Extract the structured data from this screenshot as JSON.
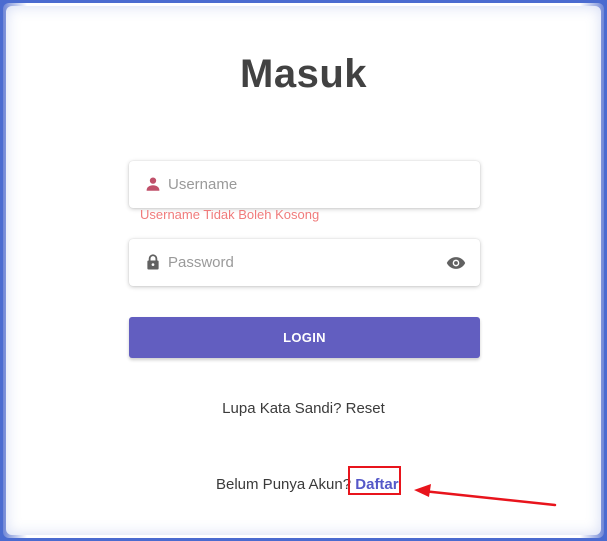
{
  "page": {
    "title": "Masuk"
  },
  "form": {
    "username": {
      "placeholder": "Username",
      "value": "",
      "error": "Username Tidak Boleh Kosong",
      "icon": "person-icon"
    },
    "password": {
      "placeholder": "Password",
      "value": "",
      "icon": "lock-icon",
      "toggle_icon": "eye-icon"
    },
    "login_label": "LOGIN"
  },
  "links": {
    "forgot_text": "Lupa Kata Sandi?",
    "reset_label": "Reset",
    "register_text": "Belum Punya Akun?",
    "daftar_label": "Daftar"
  },
  "annotation": {
    "box_color": "#e8141c",
    "arrow_color": "#e8141c"
  },
  "colors": {
    "accent": "#625ec0",
    "link": "#5558c8",
    "error": "#f07b7b",
    "icon_user": "#c0506a",
    "icon_gray": "#616161"
  }
}
